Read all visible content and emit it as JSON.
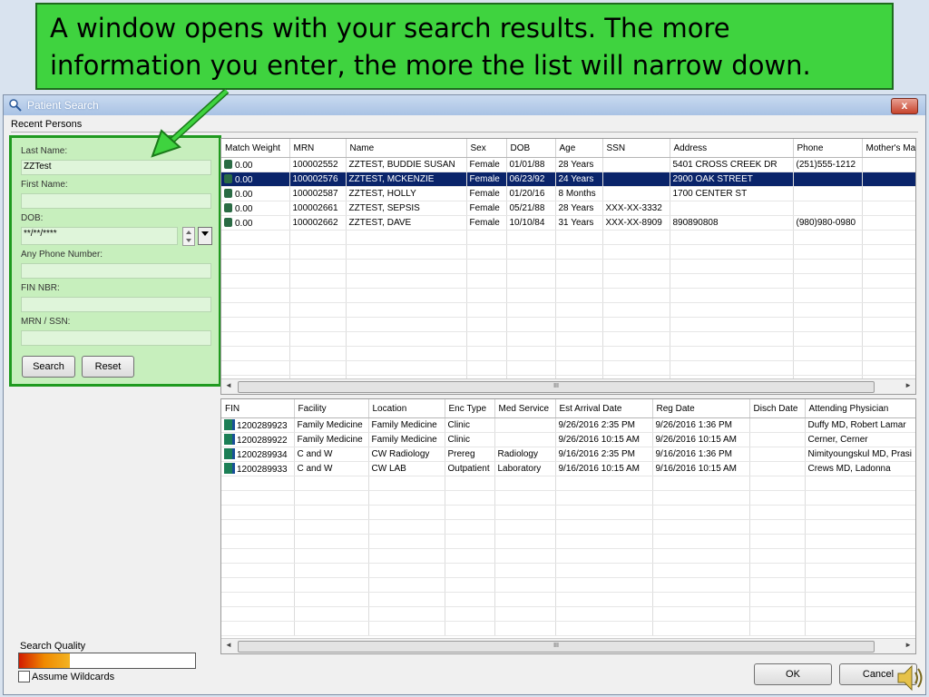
{
  "callout": {
    "line1": "A window opens with your search results.  The more",
    "line2": "information you enter, the more the list will narrow down."
  },
  "window": {
    "title": "Patient Search",
    "close_label": "x",
    "tab": "Recent Persons"
  },
  "form": {
    "last_name_label": "Last Name:",
    "last_name_value": "ZZTest",
    "first_name_label": "First Name:",
    "first_name_value": "",
    "dob_label": "DOB:",
    "dob_value": "**/**/****",
    "phone_label": "Any Phone Number:",
    "fin_label": "FIN NBR:",
    "mrn_label": "MRN / SSN:",
    "search_button": "Search",
    "reset_button": "Reset"
  },
  "quality": {
    "label": "Search Quality",
    "wildcards_label": "Assume Wildcards"
  },
  "persons": {
    "columns": [
      "Match Weight",
      "MRN",
      "Name",
      "Sex",
      "DOB",
      "Age",
      "SSN",
      "Address",
      "Phone",
      "Mother's Ma"
    ],
    "rows": [
      [
        "0.00",
        "100002552",
        "ZZTEST, BUDDIE SUSAN",
        "Female",
        "01/01/88",
        "28 Years",
        "",
        "5401 CROSS CREEK DR",
        "(251)555-1212",
        ""
      ],
      [
        "0.00",
        "100002576",
        "ZZTEST, MCKENZIE",
        "Female",
        "06/23/92",
        "24 Years",
        "",
        "2900 OAK STREET",
        "",
        ""
      ],
      [
        "0.00",
        "100002587",
        "ZZTEST, HOLLY",
        "Female",
        "01/20/16",
        "8 Months",
        "",
        "1700 CENTER ST",
        "",
        ""
      ],
      [
        "0.00",
        "100002661",
        "ZZTEST, SEPSIS",
        "Female",
        "05/21/88",
        "28 Years",
        "XXX-XX-3332",
        "",
        "",
        ""
      ],
      [
        "0.00",
        "100002662",
        "ZZTEST, DAVE",
        "Female",
        "10/10/84",
        "31 Years",
        "XXX-XX-8909",
        "890890808",
        "(980)980-0980",
        ""
      ]
    ],
    "selected_index": 1
  },
  "encounters": {
    "columns": [
      "FIN",
      "Facility",
      "Location",
      "Enc Type",
      "Med Service",
      "Est Arrival Date",
      "Reg Date",
      "Disch Date",
      "Attending Physician"
    ],
    "rows": [
      [
        "1200289923",
        "Family Medicine",
        "Family Medicine",
        "Clinic",
        "",
        "9/26/2016 2:35 PM",
        "9/26/2016 1:36 PM",
        "",
        "Duffy MD, Robert Lamar"
      ],
      [
        "1200289922",
        "Family Medicine",
        "Family Medicine",
        "Clinic",
        "",
        "9/26/2016 10:15 AM",
        "9/26/2016 10:15 AM",
        "",
        "Cerner, Cerner"
      ],
      [
        "1200289934",
        "C and W",
        "CW Radiology",
        "Prereg",
        "Radiology",
        "9/16/2016 2:35 PM",
        "9/16/2016 1:36 PM",
        "",
        "Nimityoungskul MD, Prasi"
      ],
      [
        "1200289933",
        "C and W",
        "CW LAB",
        "Outpatient",
        "Laboratory",
        "9/16/2016 10:15 AM",
        "9/16/2016 10:15 AM",
        "",
        "Crews MD, Ladonna"
      ]
    ]
  },
  "scroll_thumb_label": "III",
  "footer": {
    "ok_label": "OK",
    "cancel_label": "Cancel"
  },
  "colors": {
    "callout": "#3fd33f",
    "panel_highlight": "#1f9a1f",
    "selection": "#0a246a"
  }
}
